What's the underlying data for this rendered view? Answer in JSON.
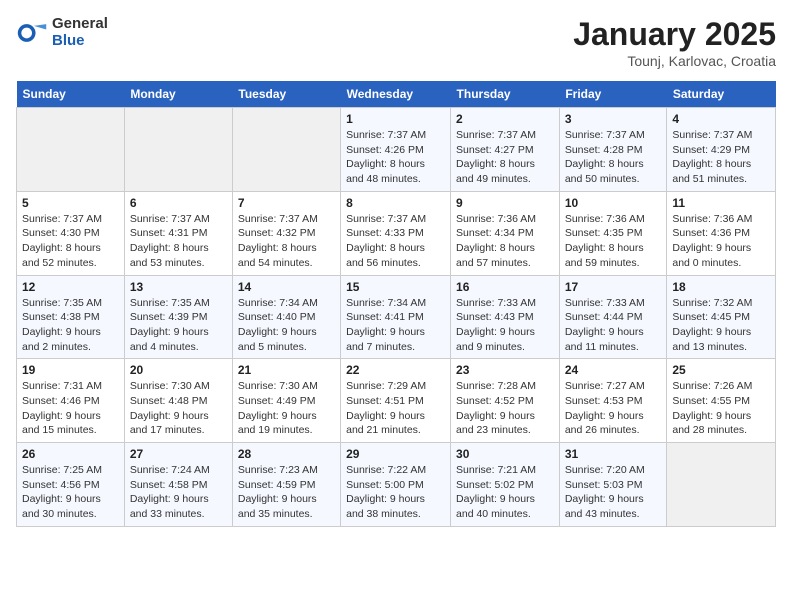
{
  "header": {
    "logo_general": "General",
    "logo_blue": "Blue",
    "month_title": "January 2025",
    "subtitle": "Tounj, Karlovac, Croatia"
  },
  "weekdays": [
    "Sunday",
    "Monday",
    "Tuesday",
    "Wednesday",
    "Thursday",
    "Friday",
    "Saturday"
  ],
  "weeks": [
    [
      {
        "day": "",
        "info": ""
      },
      {
        "day": "",
        "info": ""
      },
      {
        "day": "",
        "info": ""
      },
      {
        "day": "1",
        "info": "Sunrise: 7:37 AM\nSunset: 4:26 PM\nDaylight: 8 hours and 48 minutes."
      },
      {
        "day": "2",
        "info": "Sunrise: 7:37 AM\nSunset: 4:27 PM\nDaylight: 8 hours and 49 minutes."
      },
      {
        "day": "3",
        "info": "Sunrise: 7:37 AM\nSunset: 4:28 PM\nDaylight: 8 hours and 50 minutes."
      },
      {
        "day": "4",
        "info": "Sunrise: 7:37 AM\nSunset: 4:29 PM\nDaylight: 8 hours and 51 minutes."
      }
    ],
    [
      {
        "day": "5",
        "info": "Sunrise: 7:37 AM\nSunset: 4:30 PM\nDaylight: 8 hours and 52 minutes."
      },
      {
        "day": "6",
        "info": "Sunrise: 7:37 AM\nSunset: 4:31 PM\nDaylight: 8 hours and 53 minutes."
      },
      {
        "day": "7",
        "info": "Sunrise: 7:37 AM\nSunset: 4:32 PM\nDaylight: 8 hours and 54 minutes."
      },
      {
        "day": "8",
        "info": "Sunrise: 7:37 AM\nSunset: 4:33 PM\nDaylight: 8 hours and 56 minutes."
      },
      {
        "day": "9",
        "info": "Sunrise: 7:36 AM\nSunset: 4:34 PM\nDaylight: 8 hours and 57 minutes."
      },
      {
        "day": "10",
        "info": "Sunrise: 7:36 AM\nSunset: 4:35 PM\nDaylight: 8 hours and 59 minutes."
      },
      {
        "day": "11",
        "info": "Sunrise: 7:36 AM\nSunset: 4:36 PM\nDaylight: 9 hours and 0 minutes."
      }
    ],
    [
      {
        "day": "12",
        "info": "Sunrise: 7:35 AM\nSunset: 4:38 PM\nDaylight: 9 hours and 2 minutes."
      },
      {
        "day": "13",
        "info": "Sunrise: 7:35 AM\nSunset: 4:39 PM\nDaylight: 9 hours and 4 minutes."
      },
      {
        "day": "14",
        "info": "Sunrise: 7:34 AM\nSunset: 4:40 PM\nDaylight: 9 hours and 5 minutes."
      },
      {
        "day": "15",
        "info": "Sunrise: 7:34 AM\nSunset: 4:41 PM\nDaylight: 9 hours and 7 minutes."
      },
      {
        "day": "16",
        "info": "Sunrise: 7:33 AM\nSunset: 4:43 PM\nDaylight: 9 hours and 9 minutes."
      },
      {
        "day": "17",
        "info": "Sunrise: 7:33 AM\nSunset: 4:44 PM\nDaylight: 9 hours and 11 minutes."
      },
      {
        "day": "18",
        "info": "Sunrise: 7:32 AM\nSunset: 4:45 PM\nDaylight: 9 hours and 13 minutes."
      }
    ],
    [
      {
        "day": "19",
        "info": "Sunrise: 7:31 AM\nSunset: 4:46 PM\nDaylight: 9 hours and 15 minutes."
      },
      {
        "day": "20",
        "info": "Sunrise: 7:30 AM\nSunset: 4:48 PM\nDaylight: 9 hours and 17 minutes."
      },
      {
        "day": "21",
        "info": "Sunrise: 7:30 AM\nSunset: 4:49 PM\nDaylight: 9 hours and 19 minutes."
      },
      {
        "day": "22",
        "info": "Sunrise: 7:29 AM\nSunset: 4:51 PM\nDaylight: 9 hours and 21 minutes."
      },
      {
        "day": "23",
        "info": "Sunrise: 7:28 AM\nSunset: 4:52 PM\nDaylight: 9 hours and 23 minutes."
      },
      {
        "day": "24",
        "info": "Sunrise: 7:27 AM\nSunset: 4:53 PM\nDaylight: 9 hours and 26 minutes."
      },
      {
        "day": "25",
        "info": "Sunrise: 7:26 AM\nSunset: 4:55 PM\nDaylight: 9 hours and 28 minutes."
      }
    ],
    [
      {
        "day": "26",
        "info": "Sunrise: 7:25 AM\nSunset: 4:56 PM\nDaylight: 9 hours and 30 minutes."
      },
      {
        "day": "27",
        "info": "Sunrise: 7:24 AM\nSunset: 4:58 PM\nDaylight: 9 hours and 33 minutes."
      },
      {
        "day": "28",
        "info": "Sunrise: 7:23 AM\nSunset: 4:59 PM\nDaylight: 9 hours and 35 minutes."
      },
      {
        "day": "29",
        "info": "Sunrise: 7:22 AM\nSunset: 5:00 PM\nDaylight: 9 hours and 38 minutes."
      },
      {
        "day": "30",
        "info": "Sunrise: 7:21 AM\nSunset: 5:02 PM\nDaylight: 9 hours and 40 minutes."
      },
      {
        "day": "31",
        "info": "Sunrise: 7:20 AM\nSunset: 5:03 PM\nDaylight: 9 hours and 43 minutes."
      },
      {
        "day": "",
        "info": ""
      }
    ]
  ]
}
